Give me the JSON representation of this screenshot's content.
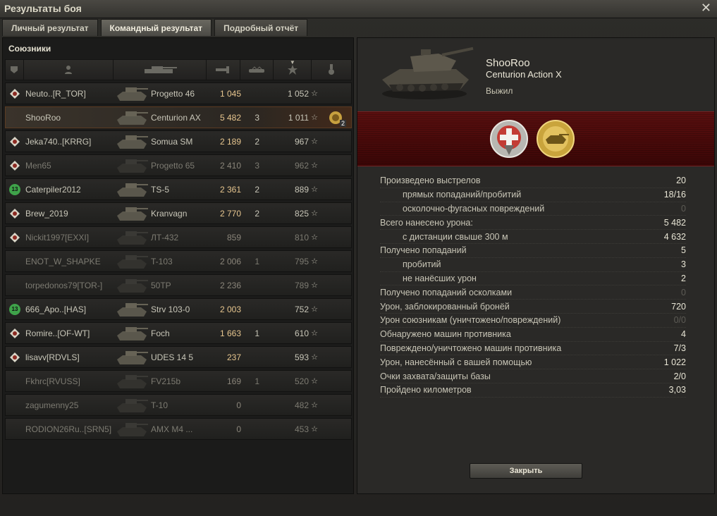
{
  "window": {
    "title": "Результаты боя",
    "close_glyph": "✕"
  },
  "tabs": [
    {
      "label": "Личный результат",
      "active": false
    },
    {
      "label": "Командный результат",
      "active": true
    },
    {
      "label": "Подробный отчёт",
      "active": false
    }
  ],
  "team": {
    "title": "Союзники",
    "headers": [
      "platoon-icon",
      "player-icon",
      "vehicle-icon",
      "damage-icon",
      "frags-icon",
      "xp-star-icon",
      "medal-icon"
    ],
    "star_glyph": "☆",
    "players": [
      {
        "platoon": "clan-emblem",
        "name": "Neuto..[R_TOR]",
        "vehicle": "Progetto 46",
        "damage": "1 045",
        "frags": "",
        "xp": "1 052",
        "alive": true,
        "me": false,
        "medal": ""
      },
      {
        "platoon": "",
        "name": "ShooRoo",
        "vehicle": "Centurion AX",
        "damage": "5 482",
        "frags": "3",
        "xp": "1 011",
        "alive": true,
        "me": true,
        "medal": "2"
      },
      {
        "platoon": "clan-emblem",
        "name": "Jeka740..[KRRG]",
        "vehicle": "Somua SM",
        "damage": "2 189",
        "frags": "2",
        "xp": "967",
        "alive": true,
        "me": false,
        "medal": ""
      },
      {
        "platoon": "clan-emblem",
        "name": "Men65",
        "vehicle": "Progetto 65",
        "damage": "2 410",
        "frags": "3",
        "xp": "962",
        "alive": false,
        "me": false,
        "medal": ""
      },
      {
        "platoon": "13",
        "name": "Caterpiler2012",
        "vehicle": "TS-5",
        "damage": "2 361",
        "frags": "2",
        "xp": "889",
        "alive": true,
        "me": false,
        "medal": ""
      },
      {
        "platoon": "clan-emblem",
        "name": "Brew_2019",
        "vehicle": "Kranvagn",
        "damage": "2 770",
        "frags": "2",
        "xp": "825",
        "alive": true,
        "me": false,
        "medal": ""
      },
      {
        "platoon": "clan-emblem",
        "name": "Nickit1997[EXXI]",
        "vehicle": "ЛТ-432",
        "damage": "859",
        "frags": "",
        "xp": "810",
        "alive": false,
        "me": false,
        "medal": ""
      },
      {
        "platoon": "",
        "name": "ENOT_W_SHAPKE",
        "vehicle": "T-103",
        "damage": "2 006",
        "frags": "1",
        "xp": "795",
        "alive": false,
        "me": false,
        "medal": ""
      },
      {
        "platoon": "",
        "name": "torpedonos79[TOR-]",
        "vehicle": "50TP",
        "damage": "2 236",
        "frags": "",
        "xp": "789",
        "alive": false,
        "me": false,
        "medal": ""
      },
      {
        "platoon": "13",
        "name": "666_Apo..[HAS]",
        "vehicle": "Strv 103-0",
        "damage": "2 003",
        "frags": "",
        "xp": "752",
        "alive": true,
        "me": false,
        "medal": ""
      },
      {
        "platoon": "clan-emblem",
        "name": "Romire..[OF-WT]",
        "vehicle": "Foch",
        "damage": "1 663",
        "frags": "1",
        "xp": "610",
        "alive": true,
        "me": false,
        "medal": ""
      },
      {
        "platoon": "clan-emblem",
        "name": "lisavv[RDVLS]",
        "vehicle": "UDES 14 5",
        "damage": "237",
        "frags": "",
        "xp": "593",
        "alive": true,
        "me": false,
        "medal": ""
      },
      {
        "platoon": "",
        "name": "Fkhrc[RVUSS]",
        "vehicle": "FV215b",
        "damage": "169",
        "frags": "1",
        "xp": "520",
        "alive": false,
        "me": false,
        "medal": ""
      },
      {
        "platoon": "",
        "name": "zagumenny25",
        "vehicle": "T-10",
        "damage": "0",
        "frags": "",
        "xp": "482",
        "alive": false,
        "me": false,
        "medal": ""
      },
      {
        "platoon": "",
        "name": "RODION26Ru..[SRN5]",
        "vehicle": "AMX M4 ...",
        "damage": "0",
        "frags": "",
        "xp": "453",
        "alive": false,
        "me": false,
        "medal": ""
      }
    ]
  },
  "detail": {
    "player": "ShooRoo",
    "vehicle": "Centurion Action X",
    "status": "Выжил",
    "stats": [
      {
        "label": "Произведено выстрелов",
        "value": "20",
        "sub": false,
        "dim": false
      },
      {
        "label": "прямых попаданий/пробитий",
        "value": "18/16",
        "sub": true,
        "dim": false
      },
      {
        "label": "осколочно-фугасных повреждений",
        "value": "0",
        "sub": true,
        "dim": true
      },
      {
        "label": "Всего нанесено урона:",
        "value": "5 482",
        "sub": false,
        "dim": false
      },
      {
        "label": "с дистанции свыше 300 м",
        "value": "4 632",
        "sub": true,
        "dim": false
      },
      {
        "label": "Получено попаданий",
        "value": "5",
        "sub": false,
        "dim": false
      },
      {
        "label": "пробитий",
        "value": "3",
        "sub": true,
        "dim": false
      },
      {
        "label": "не нанёсших урон",
        "value": "2",
        "sub": true,
        "dim": false
      },
      {
        "label": "Получено попаданий осколками",
        "value": "0",
        "sub": false,
        "dim": true
      },
      {
        "label": "Урон, заблокированный бронёй",
        "value": "720",
        "sub": false,
        "dim": false
      },
      {
        "label": "Урон союзникам (уничтожено/повреждений)",
        "value": "0/0",
        "sub": false,
        "dim": true
      },
      {
        "label": "Обнаружено машин противника",
        "value": "4",
        "sub": false,
        "dim": false
      },
      {
        "label": "Повреждено/уничтожено машин противника",
        "value": "7/3",
        "sub": false,
        "dim": false
      },
      {
        "label": "Урон, нанесённый с вашей помощью",
        "value": "1 022",
        "sub": false,
        "dim": false
      },
      {
        "label": "Очки захвата/защиты базы",
        "value": "2/0",
        "sub": false,
        "dim": false
      },
      {
        "label": "Пройдено километров",
        "value": "3,03",
        "sub": false,
        "dim": false
      }
    ],
    "close_label": "Закрыть"
  },
  "colors": {
    "accent_damage": "#e7c68f",
    "achievement_band": "#5a0f0f",
    "platoon_green": "#3fa34a"
  }
}
